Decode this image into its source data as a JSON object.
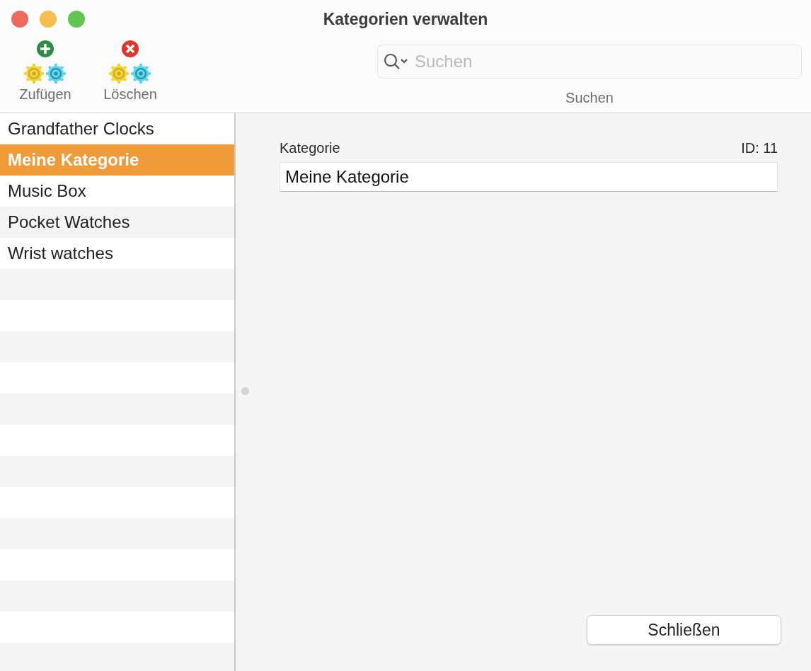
{
  "window": {
    "title": "Kategorien verwalten"
  },
  "toolbar": {
    "buttons": [
      {
        "label": "Zufügen",
        "kind": "add"
      },
      {
        "label": "Löschen",
        "kind": "delete"
      }
    ],
    "search": {
      "placeholder": "Suchen",
      "label": "Suchen"
    }
  },
  "categories": [
    {
      "name": "Grandfather Clocks",
      "selected": false
    },
    {
      "name": "Meine Kategorie",
      "selected": true
    },
    {
      "name": "Music Box",
      "selected": false
    },
    {
      "name": "Pocket Watches",
      "selected": false
    },
    {
      "name": "Wrist watches",
      "selected": false
    }
  ],
  "detail": {
    "label": "Kategorie",
    "id": "ID: 11",
    "value": "Meine Kategorie"
  },
  "close_button": "Schließen"
}
